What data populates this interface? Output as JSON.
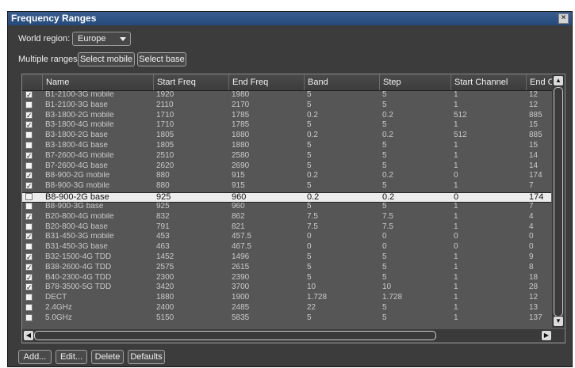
{
  "window": {
    "title": "Frequency Ranges",
    "close_glyph": "×"
  },
  "region": {
    "label": "World region:",
    "value": "Europe"
  },
  "multiple": {
    "label": "Multiple ranges",
    "select_mobile": "Select mobile",
    "select_base": "Select base"
  },
  "columns": [
    "Name",
    "Start Freq",
    "End Freq",
    "Band",
    "Step",
    "Start Channel",
    "End Ch"
  ],
  "rows": [
    {
      "checked": true,
      "name": "B1-2100-3G mobile",
      "start": "1920",
      "end": "1980",
      "band": "5",
      "step": "5",
      "sch": "1",
      "ech": "12"
    },
    {
      "checked": false,
      "name": "B1-2100-3G base",
      "start": "2110",
      "end": "2170",
      "band": "5",
      "step": "5",
      "sch": "1",
      "ech": "12"
    },
    {
      "checked": true,
      "name": "B3-1800-2G mobile",
      "start": "1710",
      "end": "1785",
      "band": "0.2",
      "step": "0.2",
      "sch": "512",
      "ech": "885"
    },
    {
      "checked": true,
      "name": "B3-1800-4G mobile",
      "start": "1710",
      "end": "1785",
      "band": "5",
      "step": "5",
      "sch": "1",
      "ech": "15"
    },
    {
      "checked": false,
      "name": "B3-1800-2G base",
      "start": "1805",
      "end": "1880",
      "band": "0.2",
      "step": "0.2",
      "sch": "512",
      "ech": "885"
    },
    {
      "checked": false,
      "name": "B3-1800-4G base",
      "start": "1805",
      "end": "1880",
      "band": "5",
      "step": "5",
      "sch": "1",
      "ech": "15"
    },
    {
      "checked": true,
      "name": "B7-2600-4G mobile",
      "start": "2510",
      "end": "2580",
      "band": "5",
      "step": "5",
      "sch": "1",
      "ech": "14"
    },
    {
      "checked": false,
      "name": "B7-2600-4G base",
      "start": "2620",
      "end": "2690",
      "band": "5",
      "step": "5",
      "sch": "1",
      "ech": "14"
    },
    {
      "checked": true,
      "name": "B8-900-2G mobile",
      "start": "880",
      "end": "915",
      "band": "0.2",
      "step": "0.2",
      "sch": "0",
      "ech": "174"
    },
    {
      "checked": true,
      "name": "B8-900-3G mobile",
      "start": "880",
      "end": "915",
      "band": "5",
      "step": "5",
      "sch": "1",
      "ech": "7"
    },
    {
      "checked": false,
      "name": "B8-900-2G base",
      "start": "925",
      "end": "960",
      "band": "0.2",
      "step": "0.2",
      "sch": "0",
      "ech": "174",
      "selected": true
    },
    {
      "checked": false,
      "name": "B8-900-3G base",
      "start": "925",
      "end": "960",
      "band": "5",
      "step": "5",
      "sch": "1",
      "ech": "7"
    },
    {
      "checked": true,
      "name": "B20-800-4G mobile",
      "start": "832",
      "end": "862",
      "band": "7.5",
      "step": "7.5",
      "sch": "1",
      "ech": "4"
    },
    {
      "checked": false,
      "name": "B20-800-4G base",
      "start": "791",
      "end": "821",
      "band": "7.5",
      "step": "7.5",
      "sch": "1",
      "ech": "4"
    },
    {
      "checked": true,
      "name": "B31-450-3G mobile",
      "start": "453",
      "end": "457.5",
      "band": "0",
      "step": "0",
      "sch": "0",
      "ech": "0"
    },
    {
      "checked": false,
      "name": "B31-450-3G base",
      "start": "463",
      "end": "467.5",
      "band": "0",
      "step": "0",
      "sch": "0",
      "ech": "0"
    },
    {
      "checked": true,
      "name": "B32-1500-4G TDD",
      "start": "1452",
      "end": "1496",
      "band": "5",
      "step": "5",
      "sch": "1",
      "ech": "9"
    },
    {
      "checked": true,
      "name": "B38-2600-4G TDD",
      "start": "2575",
      "end": "2615",
      "band": "5",
      "step": "5",
      "sch": "1",
      "ech": "8"
    },
    {
      "checked": true,
      "name": "B40-2300-4G TDD",
      "start": "2300",
      "end": "2390",
      "band": "5",
      "step": "5",
      "sch": "1",
      "ech": "18"
    },
    {
      "checked": true,
      "name": "B78-3500-5G TDD",
      "start": "3420",
      "end": "3700",
      "band": "10",
      "step": "10",
      "sch": "1",
      "ech": "28"
    },
    {
      "checked": false,
      "name": "DECT",
      "start": "1880",
      "end": "1900",
      "band": "1.728",
      "step": "1.728",
      "sch": "1",
      "ech": "12"
    },
    {
      "checked": false,
      "name": "2.4GHz",
      "start": "2400",
      "end": "2485",
      "band": "22",
      "step": "5",
      "sch": "1",
      "ech": "13"
    },
    {
      "checked": false,
      "name": "5.0GHz",
      "start": "5150",
      "end": "5835",
      "band": "5",
      "step": "5",
      "sch": "1",
      "ech": "137"
    }
  ],
  "buttons": {
    "add": "Add...",
    "edit": "Edit...",
    "delete": "Delete",
    "defaults": "Defaults"
  },
  "icons": {
    "check": "✓",
    "up": "▲",
    "down": "▼",
    "left": "◀",
    "right": "▶"
  }
}
